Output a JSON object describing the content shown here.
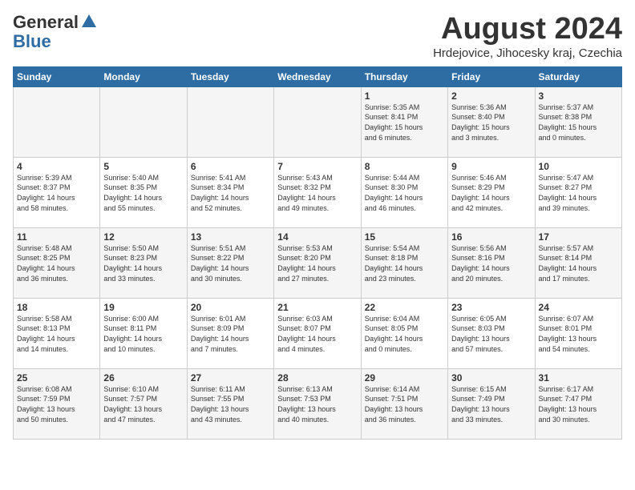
{
  "header": {
    "logo_general": "General",
    "logo_blue": "Blue",
    "month_title": "August 2024",
    "location": "Hrdejovice, Jihocesky kraj, Czechia"
  },
  "weekdays": [
    "Sunday",
    "Monday",
    "Tuesday",
    "Wednesday",
    "Thursday",
    "Friday",
    "Saturday"
  ],
  "weeks": [
    [
      {
        "day": "",
        "info": ""
      },
      {
        "day": "",
        "info": ""
      },
      {
        "day": "",
        "info": ""
      },
      {
        "day": "",
        "info": ""
      },
      {
        "day": "1",
        "info": "Sunrise: 5:35 AM\nSunset: 8:41 PM\nDaylight: 15 hours\nand 6 minutes."
      },
      {
        "day": "2",
        "info": "Sunrise: 5:36 AM\nSunset: 8:40 PM\nDaylight: 15 hours\nand 3 minutes."
      },
      {
        "day": "3",
        "info": "Sunrise: 5:37 AM\nSunset: 8:38 PM\nDaylight: 15 hours\nand 0 minutes."
      }
    ],
    [
      {
        "day": "4",
        "info": "Sunrise: 5:39 AM\nSunset: 8:37 PM\nDaylight: 14 hours\nand 58 minutes."
      },
      {
        "day": "5",
        "info": "Sunrise: 5:40 AM\nSunset: 8:35 PM\nDaylight: 14 hours\nand 55 minutes."
      },
      {
        "day": "6",
        "info": "Sunrise: 5:41 AM\nSunset: 8:34 PM\nDaylight: 14 hours\nand 52 minutes."
      },
      {
        "day": "7",
        "info": "Sunrise: 5:43 AM\nSunset: 8:32 PM\nDaylight: 14 hours\nand 49 minutes."
      },
      {
        "day": "8",
        "info": "Sunrise: 5:44 AM\nSunset: 8:30 PM\nDaylight: 14 hours\nand 46 minutes."
      },
      {
        "day": "9",
        "info": "Sunrise: 5:46 AM\nSunset: 8:29 PM\nDaylight: 14 hours\nand 42 minutes."
      },
      {
        "day": "10",
        "info": "Sunrise: 5:47 AM\nSunset: 8:27 PM\nDaylight: 14 hours\nand 39 minutes."
      }
    ],
    [
      {
        "day": "11",
        "info": "Sunrise: 5:48 AM\nSunset: 8:25 PM\nDaylight: 14 hours\nand 36 minutes."
      },
      {
        "day": "12",
        "info": "Sunrise: 5:50 AM\nSunset: 8:23 PM\nDaylight: 14 hours\nand 33 minutes."
      },
      {
        "day": "13",
        "info": "Sunrise: 5:51 AM\nSunset: 8:22 PM\nDaylight: 14 hours\nand 30 minutes."
      },
      {
        "day": "14",
        "info": "Sunrise: 5:53 AM\nSunset: 8:20 PM\nDaylight: 14 hours\nand 27 minutes."
      },
      {
        "day": "15",
        "info": "Sunrise: 5:54 AM\nSunset: 8:18 PM\nDaylight: 14 hours\nand 23 minutes."
      },
      {
        "day": "16",
        "info": "Sunrise: 5:56 AM\nSunset: 8:16 PM\nDaylight: 14 hours\nand 20 minutes."
      },
      {
        "day": "17",
        "info": "Sunrise: 5:57 AM\nSunset: 8:14 PM\nDaylight: 14 hours\nand 17 minutes."
      }
    ],
    [
      {
        "day": "18",
        "info": "Sunrise: 5:58 AM\nSunset: 8:13 PM\nDaylight: 14 hours\nand 14 minutes."
      },
      {
        "day": "19",
        "info": "Sunrise: 6:00 AM\nSunset: 8:11 PM\nDaylight: 14 hours\nand 10 minutes."
      },
      {
        "day": "20",
        "info": "Sunrise: 6:01 AM\nSunset: 8:09 PM\nDaylight: 14 hours\nand 7 minutes."
      },
      {
        "day": "21",
        "info": "Sunrise: 6:03 AM\nSunset: 8:07 PM\nDaylight: 14 hours\nand 4 minutes."
      },
      {
        "day": "22",
        "info": "Sunrise: 6:04 AM\nSunset: 8:05 PM\nDaylight: 14 hours\nand 0 minutes."
      },
      {
        "day": "23",
        "info": "Sunrise: 6:05 AM\nSunset: 8:03 PM\nDaylight: 13 hours\nand 57 minutes."
      },
      {
        "day": "24",
        "info": "Sunrise: 6:07 AM\nSunset: 8:01 PM\nDaylight: 13 hours\nand 54 minutes."
      }
    ],
    [
      {
        "day": "25",
        "info": "Sunrise: 6:08 AM\nSunset: 7:59 PM\nDaylight: 13 hours\nand 50 minutes."
      },
      {
        "day": "26",
        "info": "Sunrise: 6:10 AM\nSunset: 7:57 PM\nDaylight: 13 hours\nand 47 minutes."
      },
      {
        "day": "27",
        "info": "Sunrise: 6:11 AM\nSunset: 7:55 PM\nDaylight: 13 hours\nand 43 minutes."
      },
      {
        "day": "28",
        "info": "Sunrise: 6:13 AM\nSunset: 7:53 PM\nDaylight: 13 hours\nand 40 minutes."
      },
      {
        "day": "29",
        "info": "Sunrise: 6:14 AM\nSunset: 7:51 PM\nDaylight: 13 hours\nand 36 minutes."
      },
      {
        "day": "30",
        "info": "Sunrise: 6:15 AM\nSunset: 7:49 PM\nDaylight: 13 hours\nand 33 minutes."
      },
      {
        "day": "31",
        "info": "Sunrise: 6:17 AM\nSunset: 7:47 PM\nDaylight: 13 hours\nand 30 minutes."
      }
    ]
  ]
}
